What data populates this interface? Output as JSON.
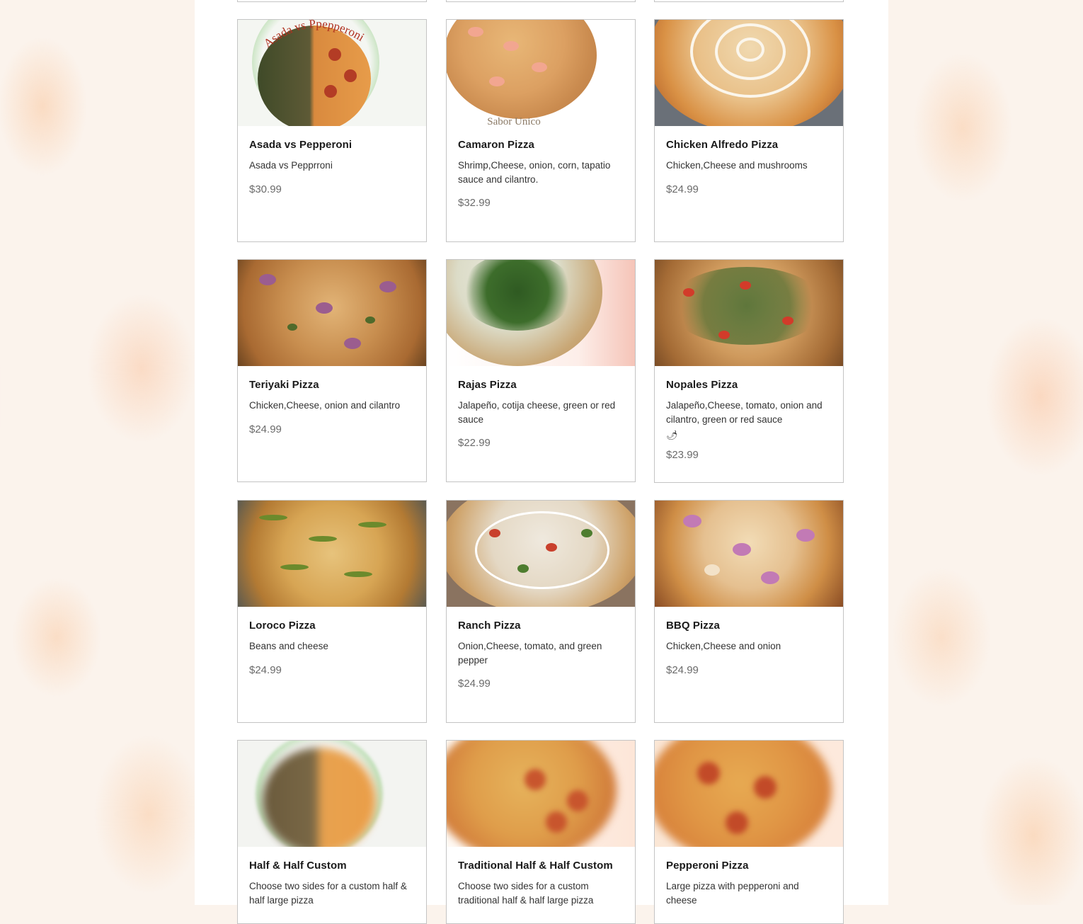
{
  "menu": {
    "items": [
      {
        "title": "Asada vs Pepperoni",
        "description": "Asada vs Pepprroni",
        "price": "$30.99",
        "image_text": "Asada vs Ppepperoni"
      },
      {
        "title": "Camaron Pizza",
        "description": "Shrimp,Cheese, onion, corn, tapatio sauce and cilantro.",
        "price": "$32.99",
        "image_text": "Sabor Unico"
      },
      {
        "title": "Chicken Alfredo Pizza",
        "description": "Chicken,Cheese and mushrooms",
        "price": "$24.99"
      },
      {
        "title": "Teriyaki Pizza",
        "description": "Chicken,Cheese, onion and cilantro",
        "price": "$24.99"
      },
      {
        "title": "Rajas Pizza",
        "description": "Jalapeño, cotija cheese, green or red sauce",
        "price": "$22.99"
      },
      {
        "title": "Nopales Pizza",
        "description": "Jalapeño,Cheese, tomato, onion and cilantro, green or red sauce",
        "emoji": "🌶",
        "price": "$23.99"
      },
      {
        "title": "Loroco Pizza",
        "description": "Beans and cheese",
        "price": "$24.99"
      },
      {
        "title": "Ranch Pizza",
        "description": "Onion,Cheese, tomato,  and green pepper",
        "price": "$24.99"
      },
      {
        "title": "BBQ Pizza",
        "description": "Chicken,Cheese and onion",
        "price": "$24.99"
      },
      {
        "title": "Half & Half Custom",
        "description": "Choose two sides for a custom half & half large pizza",
        "price": ""
      },
      {
        "title": "Traditional Half & Half Custom",
        "description": "Choose two sides for a custom traditional half & half large pizza",
        "price": ""
      },
      {
        "title": "Pepperoni Pizza",
        "description": "Large pizza with pepperoni and cheese",
        "price": ""
      }
    ]
  },
  "colors": {
    "card_border": "#c4c4c4",
    "title": "#1a1a1a",
    "description": "#333333",
    "price": "#6b6b6b"
  }
}
